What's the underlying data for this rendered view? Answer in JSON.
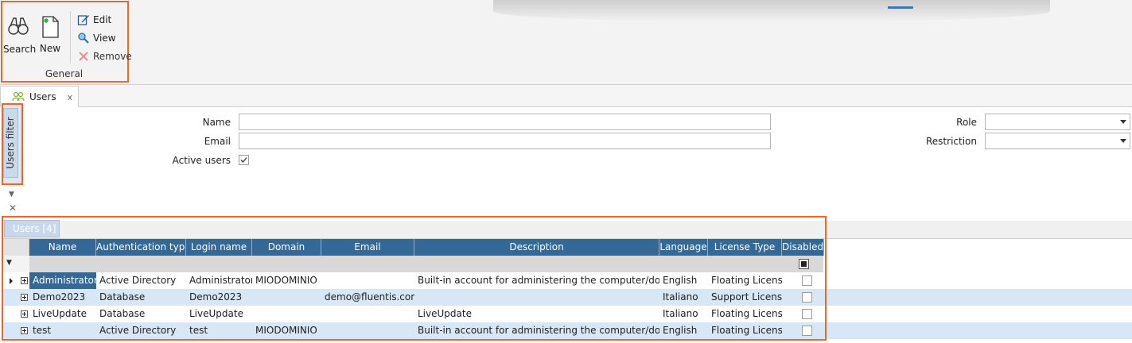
{
  "ribbon": {
    "search_label": "Search",
    "new_label": "New",
    "edit_label": "Edit",
    "view_label": "View",
    "remove_label": "Remove",
    "group_label": "General"
  },
  "document_tab": {
    "label": "Users",
    "close": "x"
  },
  "filter": {
    "side_label": "Users filter",
    "name_label": "Name",
    "name_value": "",
    "email_label": "Email",
    "email_value": "",
    "active_label": "Active users",
    "active_checked": true,
    "role_label": "Role",
    "role_value": "",
    "restriction_label": "Restriction",
    "restriction_value": ""
  },
  "grid": {
    "tab_label": "Users [4]",
    "columns": [
      "Name",
      "Authentication type",
      "Login name",
      "Domain",
      "Email",
      "Description",
      "Language",
      "License Type",
      "Disabled"
    ],
    "rows": [
      {
        "name": "Administrator",
        "auth": "Active Directory",
        "login": "Administrator",
        "domain": "MIODOMINIO",
        "email": "",
        "description": "Built-in account for administering the computer/domain",
        "language": "English",
        "license": "Floating License",
        "disabled": false
      },
      {
        "name": "Demo2023",
        "auth": "Database",
        "login": "Demo2023",
        "domain": "",
        "email": "demo@fluentis.com",
        "description": "",
        "language": "Italiano",
        "license": "Support License",
        "disabled": false
      },
      {
        "name": "LiveUpdate",
        "auth": "Database",
        "login": "LiveUpdate",
        "domain": "",
        "email": "",
        "description": "LiveUpdate",
        "language": "Italiano",
        "license": "Floating License",
        "disabled": false
      },
      {
        "name": "test",
        "auth": "Active Directory",
        "login": "test",
        "domain": "MIODOMINIO",
        "email": "",
        "description": "Built-in account for administering the computer/domain",
        "language": "English",
        "license": "Floating License",
        "disabled": false
      }
    ]
  },
  "colors": {
    "header_bg": "#346896",
    "alt_row": "#d7e7f5",
    "highlight_border": "#e8692a"
  }
}
